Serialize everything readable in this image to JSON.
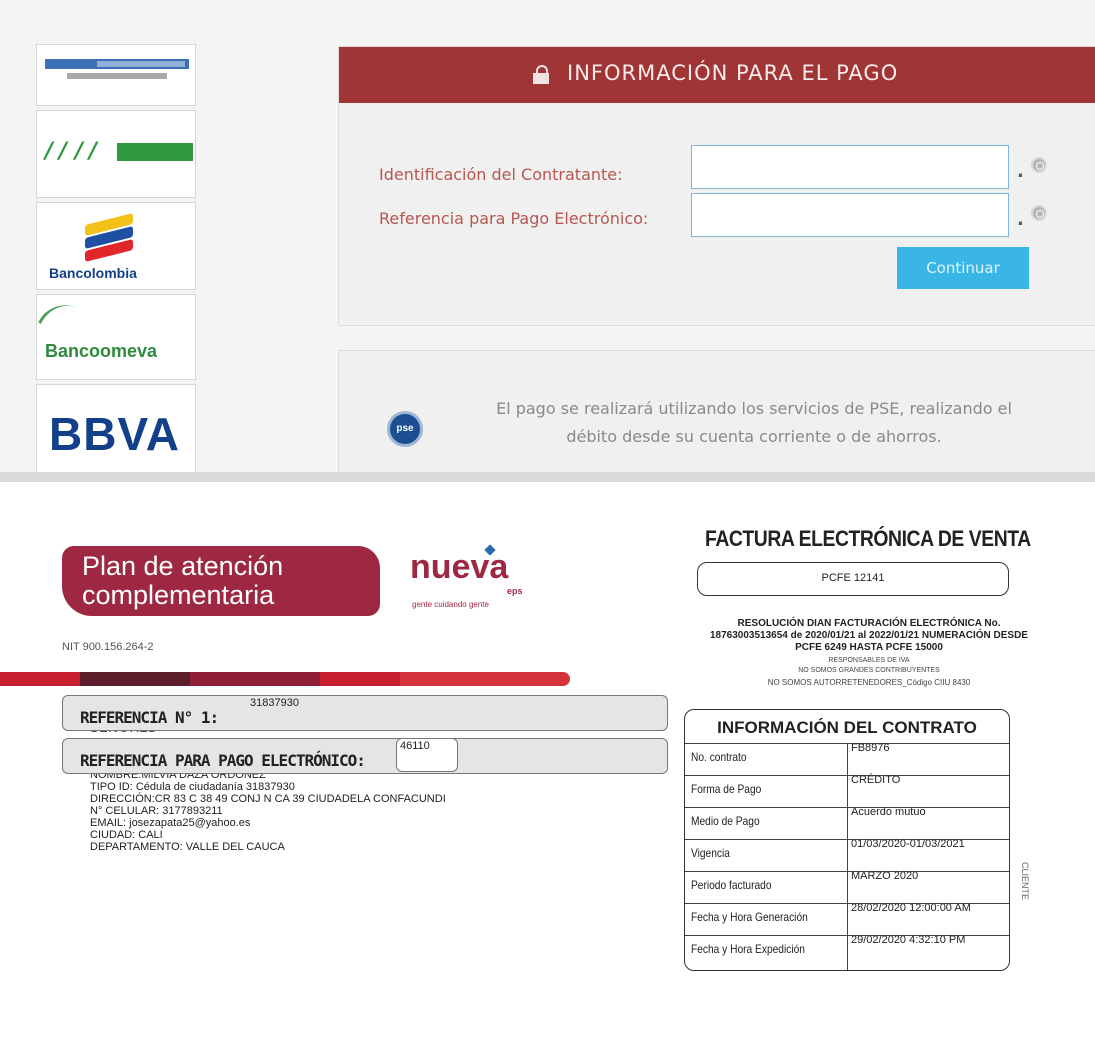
{
  "payment_screen": {
    "banks": [
      "Bancolombia",
      "Bancoomeva",
      "BBVA"
    ],
    "header_title": "INFORMACIÓN PARA EL PAGO",
    "fields": [
      {
        "label": "Identificación del Contratante:",
        "value": ""
      },
      {
        "label": "Referencia para Pago Electrónico:",
        "value": ""
      }
    ],
    "continue_label": "Continuar",
    "pse_logo_text": "pse",
    "pse_note_line1": "El pago se realizará utilizando los servicios de PSE, realizando el",
    "pse_note_line2": "débito desde su cuenta corriente o de ahorros."
  },
  "invoice": {
    "plan_line1": "Plan de atención",
    "plan_line2": "complementaria",
    "brand": "nueva",
    "brand_suffix": "eps",
    "brand_tagline": "gente cuidando gente",
    "nit": "NIT 900.156.264-2",
    "salutation": "SEÑORES",
    "client_lines": [
      "NOMBRE:MILVIA DAZA ORDOÑEZ",
      "TIPO ID: Cédula de ciudadanía 31837930",
      "DIRECCIÓN:CR 83 C 38 49 CONJ N CA 39 CIUDADELA CONFACUNDI",
      "N° CELULAR: 3177893211",
      "EMAIL: josezapata25@yahoo.es",
      "CIUDAD: CALI",
      "DEPARTAMENTO: VALLE DEL CAUCA"
    ],
    "ref1_label": "REFERENCIA N° 1:",
    "ref1_value": "31837930",
    "ref2_label": "REFERENCIA PARA PAGO ELECTRÓNICO:",
    "ref2_value": "46110",
    "title": "FACTURA ELECTRÓNICA DE VENTA",
    "pcfe": "PCFE 12141",
    "resolution_line1": "RESOLUCIÓN DIAN FACTURACIÓN ELECTRÓNICA No.",
    "resolution_line2": "18763003513654 de 2020/01/21 al 2022/01/21 NUMERACIÓN DESDE",
    "resolution_line3": "PCFE 6249 HASTA PCFE 15000",
    "note_1": "RESPONSABLES DE IVA",
    "note_2": "NO SOMOS GRANDES CONTRIBUYENTES",
    "note_3": "NO SOMOS AUTORRETENEDORES_Código CIIU 8430",
    "contract_title": "INFORMACIÓN DEL CONTRATO",
    "contract_rows": [
      {
        "label": "No. contrato",
        "value": "FB8976"
      },
      {
        "label": "Forma de Pago",
        "value": "CRÉDITO"
      },
      {
        "label": "Medio de Pago",
        "value": "Acuerdo mutuo"
      },
      {
        "label": "Vigencia",
        "value": "01/03/2020-01/03/2021"
      },
      {
        "label": "Periodo facturado",
        "value": "MARZO 2020"
      },
      {
        "label": "Fecha y Hora Generación",
        "value": "28/02/2020  12:00:00 AM"
      },
      {
        "label": "Fecha y Hora Expedición",
        "value": "29/02/2020  4:32:10 PM"
      }
    ],
    "side_label": "CLIENTE"
  }
}
